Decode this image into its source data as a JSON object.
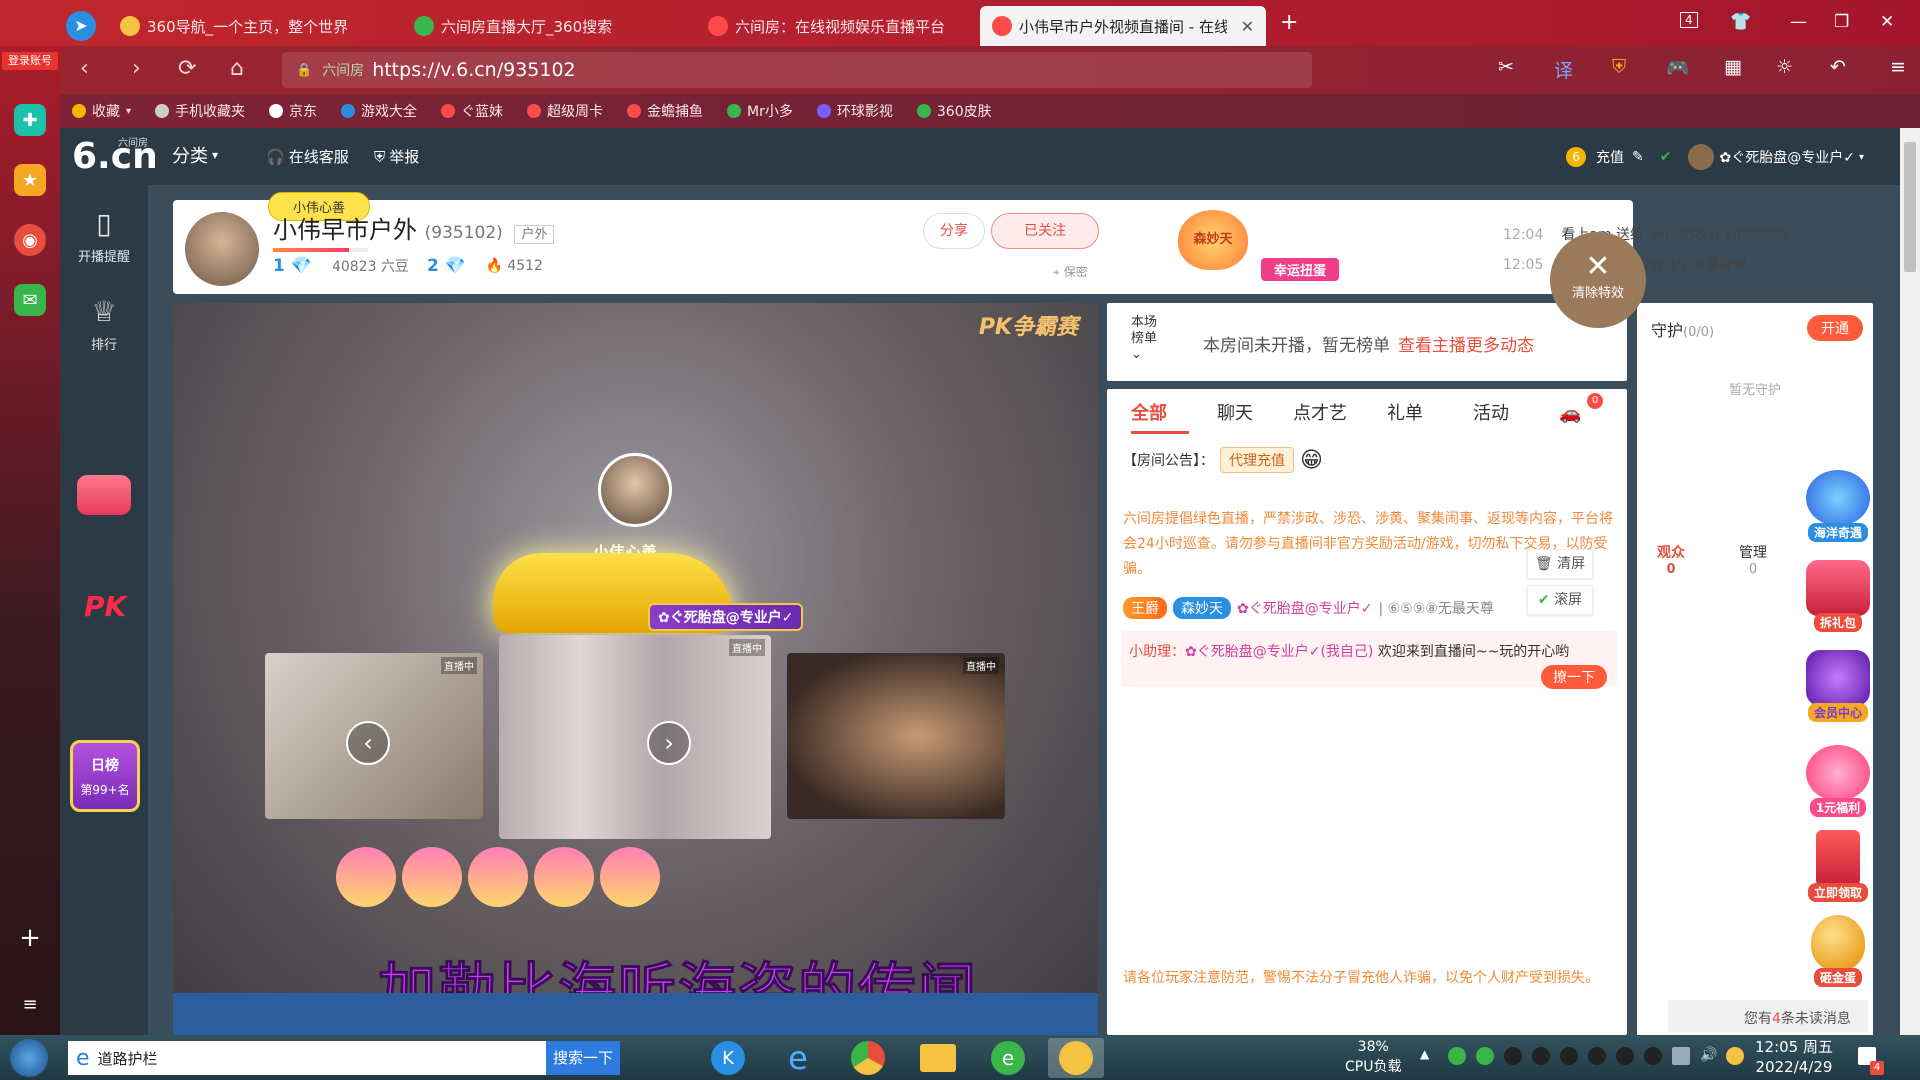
{
  "browser": {
    "tabs": [
      {
        "label": "360导航_一个主页，整个世界",
        "icon_color": "#f6c342"
      },
      {
        "label": "六间房直播大厅_360搜索",
        "icon_color": "#3ab54a"
      },
      {
        "label": "六间房：在线视频娱乐直播平台",
        "icon_color": "#ff4a4a"
      },
      {
        "label": "小伟早市户外视频直播间 - 在线",
        "icon_color": "#ff4a4a"
      }
    ],
    "login_label": "登录账号",
    "url_site": "六间房",
    "url": "https://v.6.cn/935102",
    "bookmarks": [
      {
        "label": "收藏",
        "color": "#f5b400"
      },
      {
        "label": "手机收藏夹",
        "color": "#cccccc"
      },
      {
        "label": "京东",
        "color": "#ffffff"
      },
      {
        "label": "游戏大全",
        "color": "#2a8fe0"
      },
      {
        "label": "ぐ蓝妹",
        "color": "#ff4a4a"
      },
      {
        "label": "超级周卡",
        "color": "#ff4a4a"
      },
      {
        "label": "金蟾捕鱼",
        "color": "#ff4a4a"
      },
      {
        "label": "Mr小多",
        "color": "#3ab54a"
      },
      {
        "label": "环球影视",
        "color": "#7a5cff"
      },
      {
        "label": "360皮肤",
        "color": "#3ab54a"
      }
    ],
    "tab_count": "4"
  },
  "site": {
    "logo_small": "六间房",
    "logo_main": "6.cn",
    "nav": [
      {
        "label": "分类",
        "icon": "chevron-down-icon"
      },
      {
        "label": "在线客服",
        "icon": "headset-icon"
      },
      {
        "label": "举报",
        "icon": "shield-icon"
      }
    ],
    "user": {
      "recharge": "充值",
      "username": "✿ぐ死胎盘@专业户✓"
    },
    "leftnav": [
      {
        "label": "开播提醒",
        "icon": "phone-icon"
      },
      {
        "label": "排行",
        "icon": "crown-icon"
      }
    ],
    "pk_label": "PK",
    "rank_badge": {
      "title": "日榜",
      "sub": "第99+名"
    }
  },
  "anchor": {
    "badge": "小伟心善",
    "name": "小伟早市户外",
    "room_id": "(935102)",
    "tag": "户外",
    "level1": "1",
    "beans": "40823 六豆",
    "level2": "2",
    "heat": "4512",
    "share_label": "分享",
    "follow_label": "已关注",
    "secret_label": "保密",
    "heart_label": "森妙天",
    "lucky_label": "幸运扭蛋",
    "gift_log": [
      {
        "time": "12:04",
        "text": "看上am 送给 ✧小仙女cn 1个惊鸿剑"
      },
      {
        "time": "12:05",
        "text": "送给 雨神宝宝@ 1个浪漫旋律"
      }
    ],
    "clear_fx": "清除特效"
  },
  "video": {
    "pk_title": "PK争霸赛",
    "host_name": "小伟心善",
    "car_user": "✿ぐ死胎盘@专业户✓",
    "live_label": "直播中",
    "lyrics": "加勒比海听海盗的传闻"
  },
  "rank_panel": {
    "label_line1": "本场",
    "label_line2": "榜单",
    "message": "本房间未开播，暂无榜单",
    "link": "查看主播更多动态"
  },
  "chat": {
    "tabs": [
      "全部",
      "聊天",
      "点才艺",
      "礼单",
      "活动"
    ],
    "car_count": "0",
    "notice_label": "【房间公告】：",
    "notice_tag": "代理充值",
    "warning": "六间房提倡绿色直播，严禁涉政、涉恐、涉黄、聚集闹事、返现等内容，平台将会24小时巡查。请勿参与直播间非官方奖励活动/游戏，切勿私下交易，以防受骗。",
    "clear_label": "清屏",
    "scroll_label": "滚屏",
    "enter_king": "王爵",
    "enter_lv": "森妙天",
    "enter_name": "✿ぐ死胎盘@专业户✓",
    "enter_suffix": "| ⑥⑤⑨⑧无最天尊",
    "helper_who": "小助理：",
    "helper_user": "✿ぐ死胎盘@专业户✓(我自己)",
    "helper_msg": " 欢迎来到直播间~~玩的开心哟",
    "poke_label": "撩一下",
    "footer": "请各位玩家注意防范，警惕不法分子冒充他人诈骗，以免个人财产受到损失。"
  },
  "guard": {
    "title": "守护",
    "count": "(0/0)",
    "open_label": "开通",
    "empty": "暂无守护",
    "aud_tabs": [
      {
        "label": "观众",
        "count": "0"
      },
      {
        "label": "管理",
        "count": "0"
      }
    ],
    "unread_prefix": "您有",
    "unread_count": "4",
    "unread_suffix": "条未读消息"
  },
  "widgets": [
    {
      "label": "海洋奇遇",
      "color": "#2a8fe0"
    },
    {
      "label": "拆礼包",
      "color": "#e94e3c"
    },
    {
      "label": "会员中心",
      "color": "#7a3cc9"
    },
    {
      "label": "1元福利",
      "color": "#ff4a8a"
    },
    {
      "label": "立即领取",
      "color": "#e94e3c"
    },
    {
      "label": "砸金蛋",
      "color": "#f5a623"
    }
  ],
  "taskbar": {
    "search_text": "道路护栏",
    "search_btn": "搜索一下",
    "cpu_value": "38%",
    "cpu_label": "CPU负载",
    "time": "12:05 周五",
    "date": "2022/4/29",
    "notify_count": "4"
  }
}
